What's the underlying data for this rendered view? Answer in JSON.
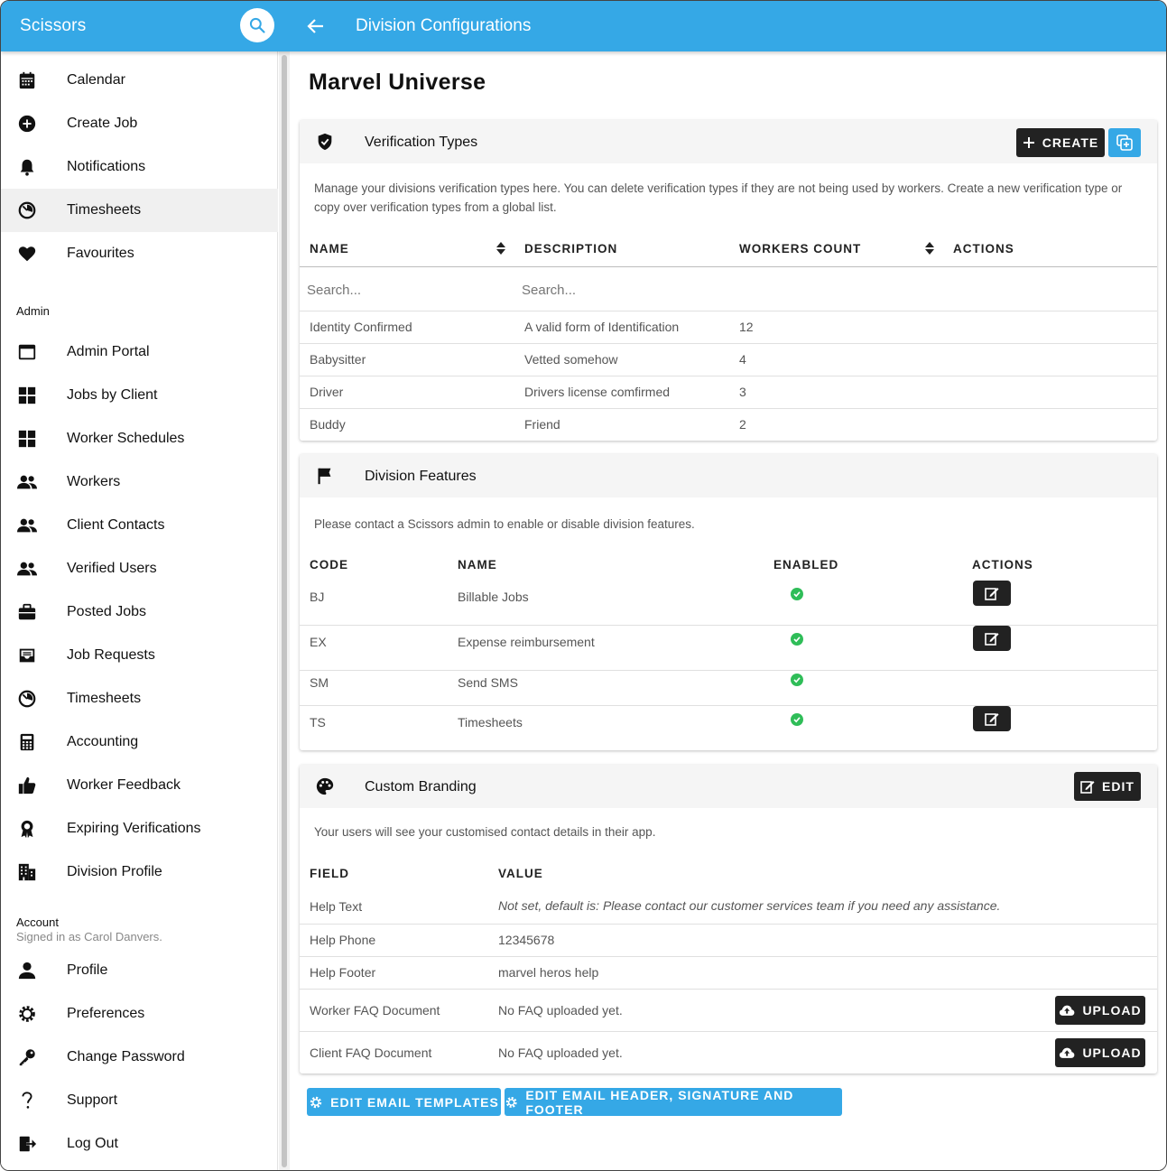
{
  "app": {
    "brand": "Scissors",
    "page_heading": "Division Configurations"
  },
  "sidebar": {
    "main_items": [
      {
        "label": "Calendar",
        "icon": "calendar-icon"
      },
      {
        "label": "Create Job",
        "icon": "add-circle-icon"
      },
      {
        "label": "Notifications",
        "icon": "bell-icon"
      },
      {
        "label": "Timesheets",
        "icon": "timer-icon",
        "active": true
      },
      {
        "label": "Favourites",
        "icon": "heart-icon"
      }
    ],
    "admin_label": "Admin",
    "admin_items": [
      {
        "label": "Admin Portal",
        "icon": "window-icon"
      },
      {
        "label": "Jobs by Client",
        "icon": "grid-icon"
      },
      {
        "label": "Worker Schedules",
        "icon": "grid-icon"
      },
      {
        "label": "Workers",
        "icon": "people-icon"
      },
      {
        "label": "Client Contacts",
        "icon": "people-icon"
      },
      {
        "label": "Verified Users",
        "icon": "people-icon"
      },
      {
        "label": "Posted Jobs",
        "icon": "briefcase-icon"
      },
      {
        "label": "Job Requests",
        "icon": "inbox-icon"
      },
      {
        "label": "Timesheets",
        "icon": "timer-icon"
      },
      {
        "label": "Accounting",
        "icon": "calculator-icon"
      },
      {
        "label": "Worker Feedback",
        "icon": "thumbs-up-icon"
      },
      {
        "label": "Expiring Verifications",
        "icon": "award-icon"
      },
      {
        "label": "Division Profile",
        "icon": "building-icon"
      }
    ],
    "account_label": "Account",
    "signed_in": "Signed in as Carol Danvers.",
    "account_items": [
      {
        "label": "Profile",
        "icon": "person-icon"
      },
      {
        "label": "Preferences",
        "icon": "cog-icon"
      },
      {
        "label": "Change Password",
        "icon": "key-icon"
      },
      {
        "label": "Support",
        "icon": "help-icon"
      },
      {
        "label": "Log Out",
        "icon": "logout-icon"
      }
    ]
  },
  "main": {
    "title": "Marvel Universe",
    "verification": {
      "title": "Verification Types",
      "create_label": "CREATE",
      "description": "Manage your divisions verification types here. You can delete verification types if they are not being used by workers. Create a new verification type or copy over verification types from a global list.",
      "columns": [
        "NAME",
        "DESCRIPTION",
        "WORKERS COUNT",
        "ACTIONS"
      ],
      "search_placeholder": "Search...",
      "rows": [
        {
          "name": "Identity Confirmed",
          "description": "A valid form of Identification",
          "count": "12"
        },
        {
          "name": "Babysitter",
          "description": "Vetted somehow",
          "count": "4"
        },
        {
          "name": "Driver",
          "description": "Drivers license comfirmed",
          "count": "3"
        },
        {
          "name": "Buddy",
          "description": "Friend",
          "count": "2"
        }
      ]
    },
    "features": {
      "title": "Division Features",
      "description": "Please contact a Scissors admin to enable or disable division features.",
      "columns": [
        "CODE",
        "NAME",
        "ENABLED",
        "ACTIONS"
      ],
      "rows": [
        {
          "code": "BJ",
          "name": "Billable Jobs",
          "enabled": true,
          "editable": true
        },
        {
          "code": "EX",
          "name": "Expense reimbursement",
          "enabled": true,
          "editable": true
        },
        {
          "code": "SM",
          "name": "Send SMS",
          "enabled": true,
          "editable": false
        },
        {
          "code": "TS",
          "name": "Timesheets",
          "enabled": true,
          "editable": true
        }
      ]
    },
    "branding": {
      "title": "Custom Branding",
      "edit_label": "EDIT",
      "description": "Your users will see your customised contact details in their app.",
      "columns": [
        "FIELD",
        "VALUE"
      ],
      "rows": [
        {
          "field": "Help Text",
          "value": "Not set, default is: Please contact our customer services team if you need any assistance."
        },
        {
          "field": "Help Phone",
          "value": "12345678"
        },
        {
          "field": "Help Footer",
          "value": "marvel heros help"
        },
        {
          "field": "Worker FAQ Document",
          "value": "No FAQ uploaded yet."
        },
        {
          "field": "Client FAQ Document",
          "value": "No FAQ uploaded yet."
        }
      ],
      "upload_label": "UPLOAD"
    },
    "buttons": {
      "edit_templates": "EDIT EMAIL TEMPLATES",
      "edit_header": "EDIT EMAIL HEADER, SIGNATURE AND FOOTER"
    }
  },
  "colors": {
    "accent": "#35a8e6",
    "dark": "#222222",
    "success": "#2fbd58"
  }
}
